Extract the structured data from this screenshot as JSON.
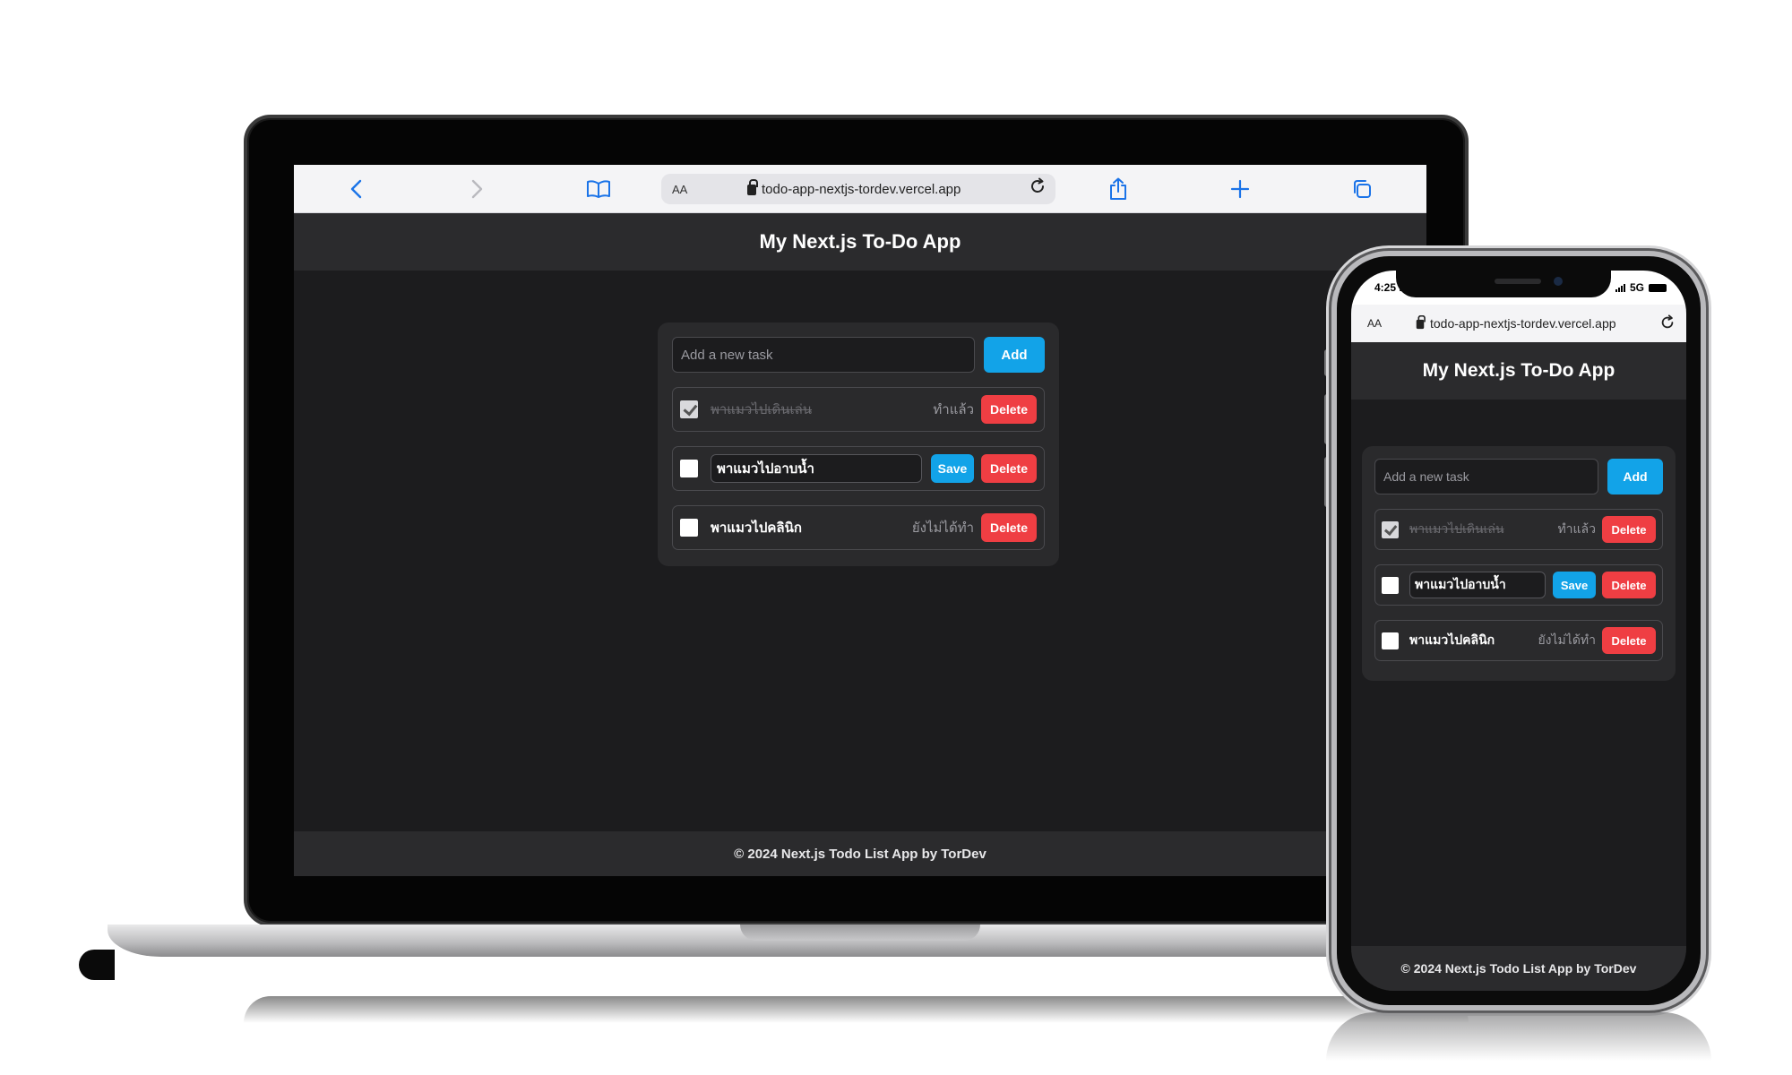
{
  "browser": {
    "text_size_label": "AA",
    "url": "todo-app-nextjs-tordev.vercel.app",
    "icons": [
      "back-icon",
      "forward-icon",
      "bookmarks-icon",
      "lock-icon",
      "reload-icon",
      "share-icon",
      "new-tab-icon",
      "tabs-icon"
    ]
  },
  "app": {
    "title": "My Next.js To-Do App",
    "new_task_placeholder": "Add a new task",
    "add_label": "Add",
    "save_label": "Save",
    "delete_label": "Delete",
    "tasks": [
      {
        "text": "พาแมวไปเดินเล่น",
        "done": true,
        "status": "ทำแล้ว"
      },
      {
        "text": "พาแมวไปอาบน้ำ",
        "done": false,
        "editing": true
      },
      {
        "text": "พาแมวไปคลินิก",
        "done": false,
        "status": "ยังไม่ได้ทำ"
      }
    ],
    "footer": "© 2024 Next.js Todo List App by TorDev"
  },
  "phone_status": {
    "time": "4:25 PM",
    "network": "5G"
  },
  "colors": {
    "accent_blue": "#12a3e8",
    "danger_red": "#ef3e43",
    "bg_dark": "#1c1c1e",
    "header_bg": "#2b2b2d"
  }
}
